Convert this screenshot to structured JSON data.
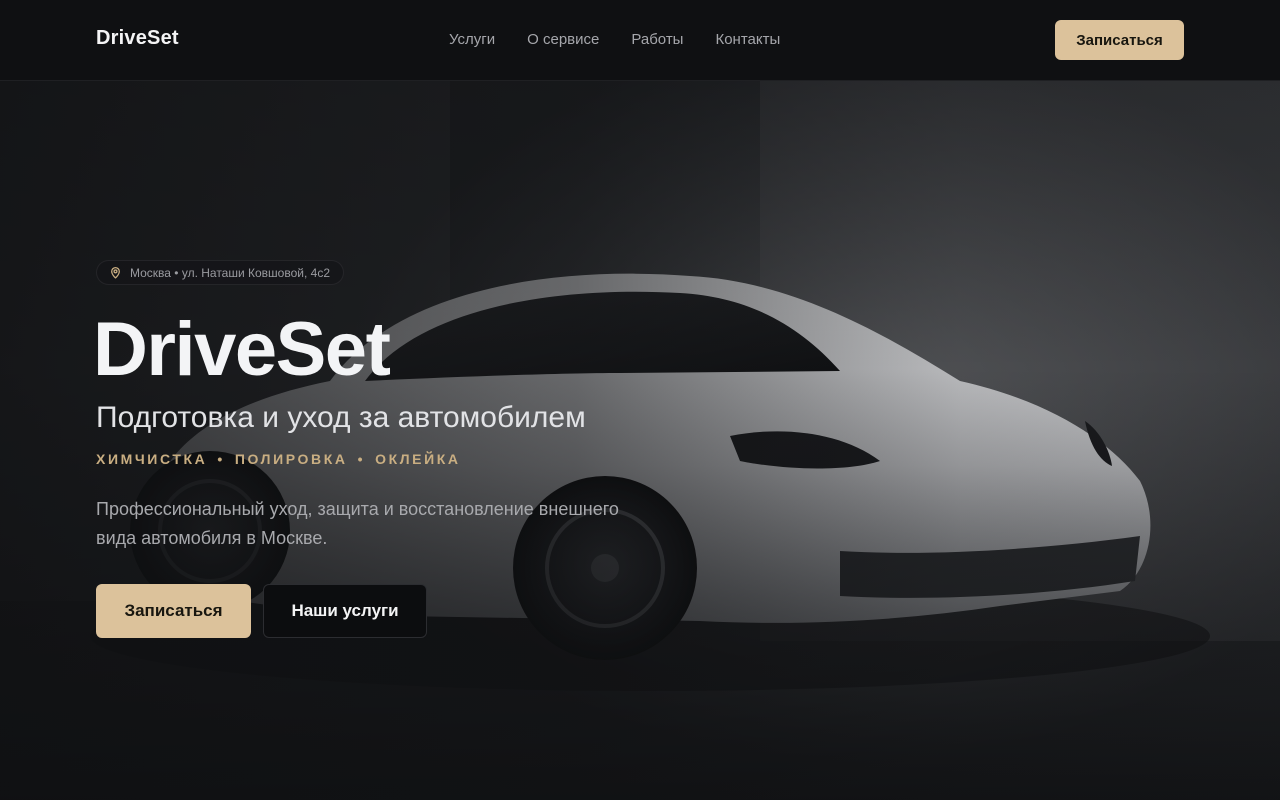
{
  "header": {
    "logo": "DriveSet",
    "nav": [
      "Услуги",
      "О сервисе",
      "Работы",
      "Контакты"
    ],
    "cta_label": "Записаться"
  },
  "hero": {
    "location": "Москва • ул. Наташи Ковшовой, 4с2",
    "title": "DriveSet",
    "subtitle": "Подготовка и уход за автомобилем",
    "services": [
      "ХИМЧИСТКА",
      "ПОЛИРОВКА",
      "ОКЛЕЙКА"
    ],
    "services_separator": "•",
    "description": "Профессиональный уход, защита и восстановление внешнего вида автомобиля в Москве.",
    "primary_button": "Записаться",
    "secondary_button": "Наши услуги"
  },
  "icons": {
    "location": "map-pin-icon"
  },
  "colors": {
    "background": "#0f1012",
    "accent": "#dcc29b",
    "accent_text": "#c9ae82",
    "text_primary": "#f3f4f6",
    "text_muted": "#a8a9ad"
  }
}
